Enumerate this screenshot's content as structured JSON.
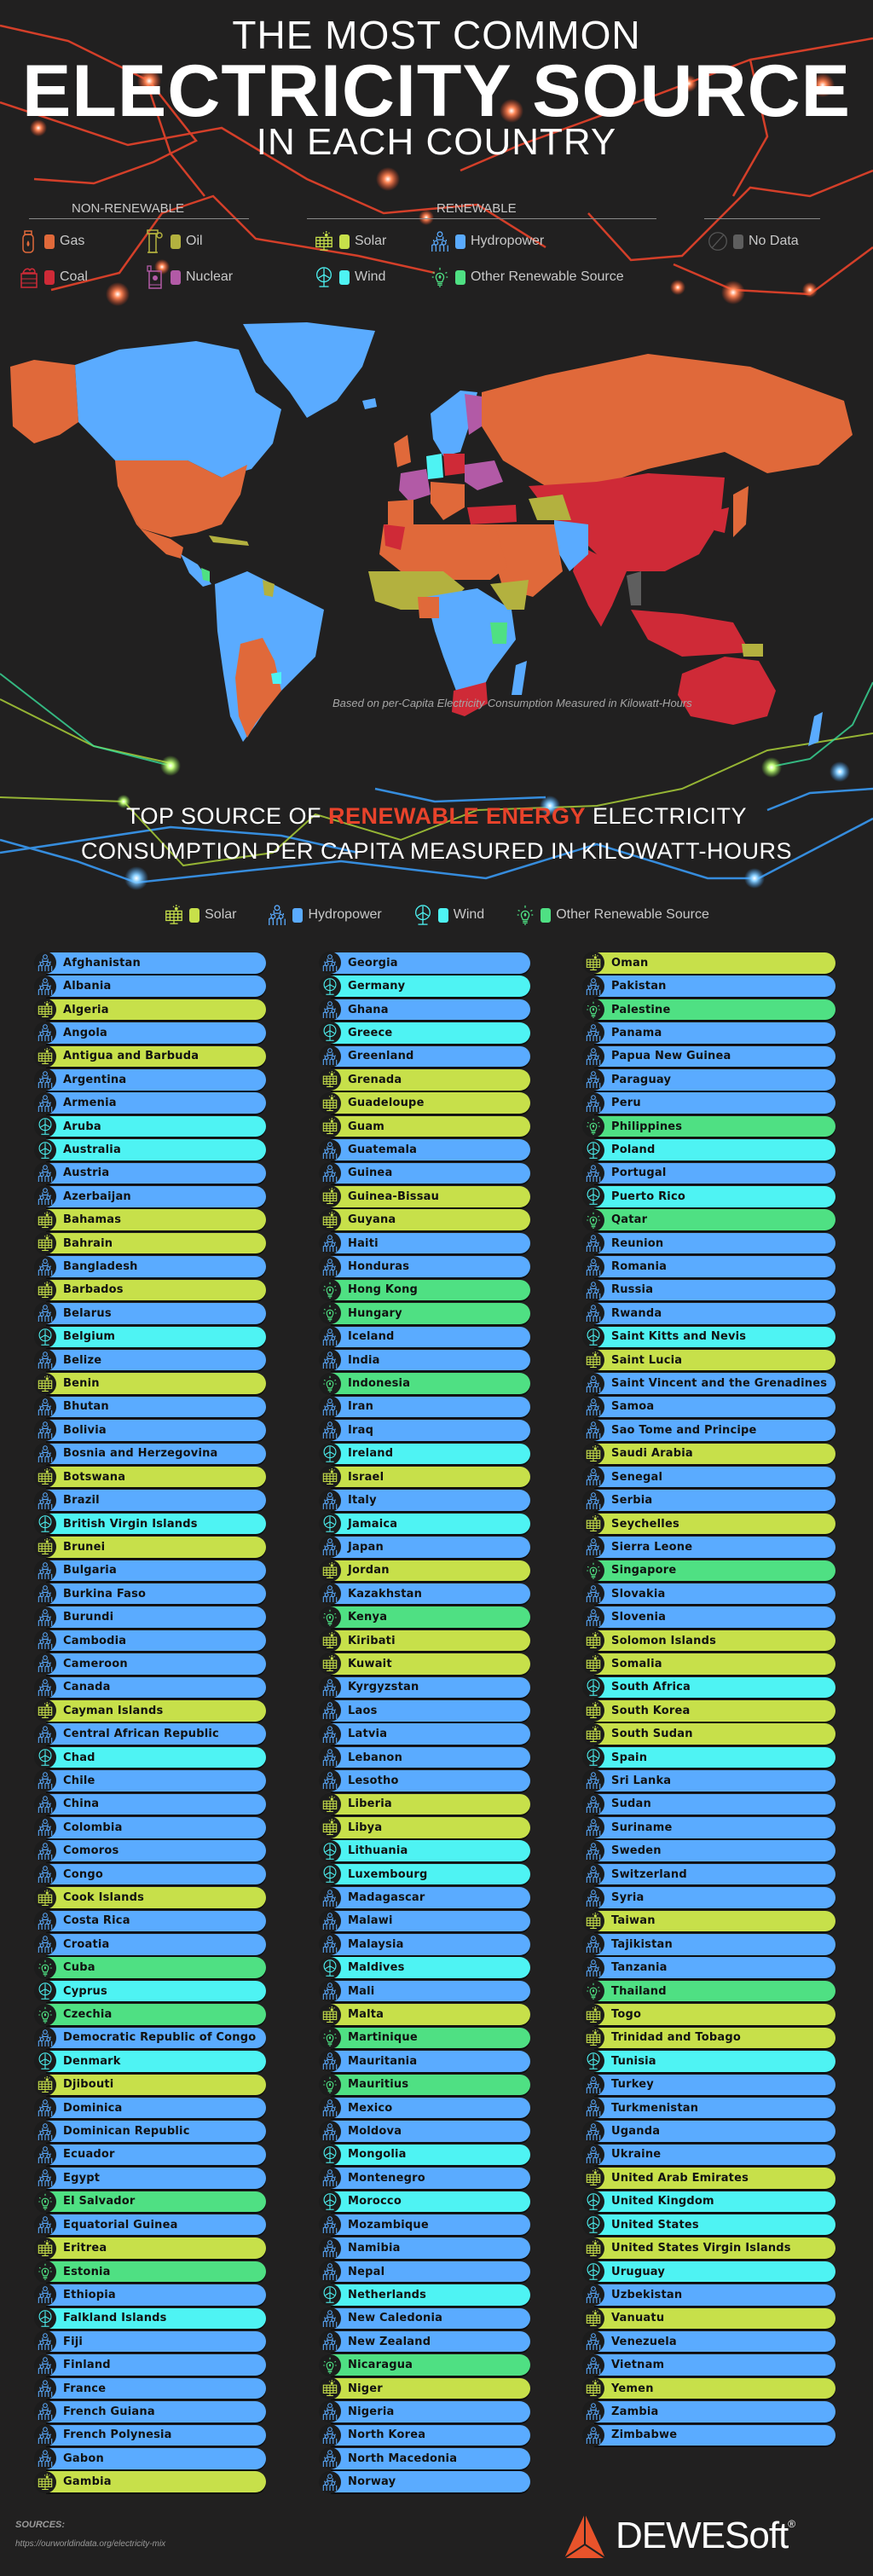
{
  "header": {
    "line1": "THE MOST COMMON",
    "line2": "ELECTRICITY SOURCE",
    "line3": "IN EACH COUNTRY"
  },
  "colors": {
    "gas": "#e0693a",
    "coal": "#cf2a37",
    "oil": "#b3b13f",
    "nuclear": "#b25aa6",
    "solar": "#c7e04a",
    "hydropower": "#5aabff",
    "wind": "#4ef3f3",
    "other": "#4fe083",
    "nodata": "#5e5e5e",
    "accent": "#e8432b",
    "background": "#212020"
  },
  "legend": {
    "non_renewable_title": "NON-RENEWABLE",
    "renewable_title": "RENEWABLE",
    "items": {
      "gas": "Gas",
      "oil": "Oil",
      "coal": "Coal",
      "nuclear": "Nuclear",
      "solar": "Solar",
      "hydropower": "Hydropower",
      "wind": "Wind",
      "other": "Other Renewable Source",
      "nodata": "No Data"
    }
  },
  "map": {
    "note": "Based on per-Capita Electricity Consumption Measured in Kilowatt-Hours"
  },
  "section2": {
    "line1_pre": "TOP SOURCE OF ",
    "line1_accent": "RENEWABLE ENERGY",
    "line1_post": " ELECTRICITY",
    "line2": "CONSUMPTION PER CAPITA MEASURED IN KILOWATT-HOURS",
    "legend": {
      "solar": "Solar",
      "hydropower": "Hydropower",
      "wind": "Wind",
      "other": "Other Renewable Source"
    }
  },
  "countries": {
    "col1": [
      {
        "name": "Afghanistan",
        "source": "hydropower"
      },
      {
        "name": "Albania",
        "source": "hydropower"
      },
      {
        "name": "Algeria",
        "source": "solar"
      },
      {
        "name": "Angola",
        "source": "hydropower"
      },
      {
        "name": "Antigua and Barbuda",
        "source": "solar"
      },
      {
        "name": "Argentina",
        "source": "hydropower"
      },
      {
        "name": "Armenia",
        "source": "hydropower"
      },
      {
        "name": "Aruba",
        "source": "wind"
      },
      {
        "name": "Australia",
        "source": "wind"
      },
      {
        "name": "Austria",
        "source": "hydropower"
      },
      {
        "name": "Azerbaijan",
        "source": "hydropower"
      },
      {
        "name": "Bahamas",
        "source": "solar"
      },
      {
        "name": "Bahrain",
        "source": "solar"
      },
      {
        "name": "Bangladesh",
        "source": "hydropower"
      },
      {
        "name": "Barbados",
        "source": "solar"
      },
      {
        "name": "Belarus",
        "source": "hydropower"
      },
      {
        "name": "Belgium",
        "source": "wind"
      },
      {
        "name": "Belize",
        "source": "hydropower"
      },
      {
        "name": "Benin",
        "source": "solar"
      },
      {
        "name": "Bhutan",
        "source": "hydropower"
      },
      {
        "name": "Bolivia",
        "source": "hydropower"
      },
      {
        "name": "Bosnia and Herzegovina",
        "source": "hydropower"
      },
      {
        "name": "Botswana",
        "source": "solar"
      },
      {
        "name": "Brazil",
        "source": "hydropower"
      },
      {
        "name": "British Virgin Islands",
        "source": "wind"
      },
      {
        "name": "Brunei",
        "source": "solar"
      },
      {
        "name": "Bulgaria",
        "source": "hydropower"
      },
      {
        "name": "Burkina Faso",
        "source": "hydropower"
      },
      {
        "name": "Burundi",
        "source": "hydropower"
      },
      {
        "name": "Cambodia",
        "source": "hydropower"
      },
      {
        "name": "Cameroon",
        "source": "hydropower"
      },
      {
        "name": "Canada",
        "source": "hydropower"
      },
      {
        "name": "Cayman Islands",
        "source": "solar"
      },
      {
        "name": "Central African Republic",
        "source": "hydropower"
      },
      {
        "name": "Chad",
        "source": "wind"
      },
      {
        "name": "Chile",
        "source": "hydropower"
      },
      {
        "name": "China",
        "source": "hydropower"
      },
      {
        "name": "Colombia",
        "source": "hydropower"
      },
      {
        "name": "Comoros",
        "source": "hydropower"
      },
      {
        "name": "Congo",
        "source": "hydropower"
      },
      {
        "name": "Cook Islands",
        "source": "solar"
      },
      {
        "name": "Costa Rica",
        "source": "hydropower"
      },
      {
        "name": "Croatia",
        "source": "hydropower"
      },
      {
        "name": "Cuba",
        "source": "other"
      },
      {
        "name": "Cyprus",
        "source": "wind"
      },
      {
        "name": "Czechia",
        "source": "other"
      },
      {
        "name": "Democratic Republic of Congo",
        "source": "hydropower"
      },
      {
        "name": "Denmark",
        "source": "wind"
      },
      {
        "name": "Djibouti",
        "source": "solar"
      },
      {
        "name": "Dominica",
        "source": "hydropower"
      },
      {
        "name": "Dominican Republic",
        "source": "hydropower"
      },
      {
        "name": "Ecuador",
        "source": "hydropower"
      },
      {
        "name": "Egypt",
        "source": "hydropower"
      },
      {
        "name": "El Salvador",
        "source": "other"
      },
      {
        "name": "Equatorial Guinea",
        "source": "hydropower"
      },
      {
        "name": "Eritrea",
        "source": "solar"
      },
      {
        "name": "Estonia",
        "source": "other"
      },
      {
        "name": "Ethiopia",
        "source": "hydropower"
      },
      {
        "name": "Falkland Islands",
        "source": "wind"
      },
      {
        "name": "Fiji",
        "source": "hydropower"
      },
      {
        "name": "Finland",
        "source": "hydropower"
      },
      {
        "name": "France",
        "source": "hydropower"
      },
      {
        "name": "French Guiana",
        "source": "hydropower"
      },
      {
        "name": "French Polynesia",
        "source": "hydropower"
      },
      {
        "name": "Gabon",
        "source": "hydropower"
      },
      {
        "name": "Gambia",
        "source": "solar"
      }
    ],
    "col2": [
      {
        "name": "Georgia",
        "source": "hydropower"
      },
      {
        "name": "Germany",
        "source": "wind"
      },
      {
        "name": "Ghana",
        "source": "hydropower"
      },
      {
        "name": "Greece",
        "source": "wind"
      },
      {
        "name": "Greenland",
        "source": "hydropower"
      },
      {
        "name": "Grenada",
        "source": "solar"
      },
      {
        "name": "Guadeloupe",
        "source": "solar"
      },
      {
        "name": "Guam",
        "source": "solar"
      },
      {
        "name": "Guatemala",
        "source": "hydropower"
      },
      {
        "name": "Guinea",
        "source": "hydropower"
      },
      {
        "name": "Guinea-Bissau",
        "source": "solar"
      },
      {
        "name": "Guyana",
        "source": "solar"
      },
      {
        "name": "Haiti",
        "source": "hydropower"
      },
      {
        "name": "Honduras",
        "source": "hydropower"
      },
      {
        "name": "Hong Kong",
        "source": "other"
      },
      {
        "name": "Hungary",
        "source": "other"
      },
      {
        "name": "Iceland",
        "source": "hydropower"
      },
      {
        "name": "India",
        "source": "hydropower"
      },
      {
        "name": "Indonesia",
        "source": "other"
      },
      {
        "name": "Iran",
        "source": "hydropower"
      },
      {
        "name": "Iraq",
        "source": "hydropower"
      },
      {
        "name": "Ireland",
        "source": "wind"
      },
      {
        "name": "Israel",
        "source": "solar"
      },
      {
        "name": "Italy",
        "source": "hydropower"
      },
      {
        "name": "Jamaica",
        "source": "wind"
      },
      {
        "name": "Japan",
        "source": "hydropower"
      },
      {
        "name": "Jordan",
        "source": "solar"
      },
      {
        "name": "Kazakhstan",
        "source": "hydropower"
      },
      {
        "name": "Kenya",
        "source": "other"
      },
      {
        "name": "Kiribati",
        "source": "solar"
      },
      {
        "name": "Kuwait",
        "source": "solar"
      },
      {
        "name": "Kyrgyzstan",
        "source": "hydropower"
      },
      {
        "name": "Laos",
        "source": "hydropower"
      },
      {
        "name": "Latvia",
        "source": "hydropower"
      },
      {
        "name": "Lebanon",
        "source": "hydropower"
      },
      {
        "name": "Lesotho",
        "source": "hydropower"
      },
      {
        "name": "Liberia",
        "source": "solar"
      },
      {
        "name": "Libya",
        "source": "solar"
      },
      {
        "name": "Lithuania",
        "source": "wind"
      },
      {
        "name": "Luxembourg",
        "source": "wind"
      },
      {
        "name": "Madagascar",
        "source": "hydropower"
      },
      {
        "name": "Malawi",
        "source": "hydropower"
      },
      {
        "name": "Malaysia",
        "source": "hydropower"
      },
      {
        "name": "Maldives",
        "source": "wind"
      },
      {
        "name": "Mali",
        "source": "hydropower"
      },
      {
        "name": "Malta",
        "source": "solar"
      },
      {
        "name": "Martinique",
        "source": "other"
      },
      {
        "name": "Mauritania",
        "source": "hydropower"
      },
      {
        "name": "Mauritius",
        "source": "other"
      },
      {
        "name": "Mexico",
        "source": "hydropower"
      },
      {
        "name": "Moldova",
        "source": "hydropower"
      },
      {
        "name": "Mongolia",
        "source": "wind"
      },
      {
        "name": "Montenegro",
        "source": "hydropower"
      },
      {
        "name": "Morocco",
        "source": "wind"
      },
      {
        "name": "Mozambique",
        "source": "hydropower"
      },
      {
        "name": "Namibia",
        "source": "hydropower"
      },
      {
        "name": "Nepal",
        "source": "hydropower"
      },
      {
        "name": "Netherlands",
        "source": "wind"
      },
      {
        "name": "New Caledonia",
        "source": "hydropower"
      },
      {
        "name": "New Zealand",
        "source": "hydropower"
      },
      {
        "name": "Nicaragua",
        "source": "other"
      },
      {
        "name": "Niger",
        "source": "solar"
      },
      {
        "name": "Nigeria",
        "source": "hydropower"
      },
      {
        "name": "North Korea",
        "source": "hydropower"
      },
      {
        "name": "North Macedonia",
        "source": "hydropower"
      },
      {
        "name": "Norway",
        "source": "hydropower"
      }
    ],
    "col3": [
      {
        "name": "Oman",
        "source": "solar"
      },
      {
        "name": "Pakistan",
        "source": "hydropower"
      },
      {
        "name": "Palestine",
        "source": "other"
      },
      {
        "name": "Panama",
        "source": "hydropower"
      },
      {
        "name": "Papua New Guinea",
        "source": "hydropower"
      },
      {
        "name": "Paraguay",
        "source": "hydropower"
      },
      {
        "name": "Peru",
        "source": "hydropower"
      },
      {
        "name": "Philippines",
        "source": "other"
      },
      {
        "name": "Poland",
        "source": "wind"
      },
      {
        "name": "Portugal",
        "source": "hydropower"
      },
      {
        "name": "Puerto Rico",
        "source": "wind"
      },
      {
        "name": "Qatar",
        "source": "other"
      },
      {
        "name": "Reunion",
        "source": "hydropower"
      },
      {
        "name": "Romania",
        "source": "hydropower"
      },
      {
        "name": "Russia",
        "source": "hydropower"
      },
      {
        "name": "Rwanda",
        "source": "hydropower"
      },
      {
        "name": "Saint Kitts and Nevis",
        "source": "wind"
      },
      {
        "name": "Saint Lucia",
        "source": "solar"
      },
      {
        "name": "Saint Vincent and the Grenadines",
        "source": "hydropower"
      },
      {
        "name": "Samoa",
        "source": "hydropower"
      },
      {
        "name": "Sao Tome and Principe",
        "source": "hydropower"
      },
      {
        "name": "Saudi Arabia",
        "source": "solar"
      },
      {
        "name": "Senegal",
        "source": "hydropower"
      },
      {
        "name": "Serbia",
        "source": "hydropower"
      },
      {
        "name": "Seychelles",
        "source": "solar"
      },
      {
        "name": "Sierra Leone",
        "source": "hydropower"
      },
      {
        "name": "Singapore",
        "source": "other"
      },
      {
        "name": "Slovakia",
        "source": "hydropower"
      },
      {
        "name": "Slovenia",
        "source": "hydropower"
      },
      {
        "name": "Solomon Islands",
        "source": "solar"
      },
      {
        "name": "Somalia",
        "source": "solar"
      },
      {
        "name": "South Africa",
        "source": "wind"
      },
      {
        "name": "South Korea",
        "source": "solar"
      },
      {
        "name": "South Sudan",
        "source": "solar"
      },
      {
        "name": "Spain",
        "source": "wind"
      },
      {
        "name": "Sri Lanka",
        "source": "hydropower"
      },
      {
        "name": "Sudan",
        "source": "hydropower"
      },
      {
        "name": "Suriname",
        "source": "hydropower"
      },
      {
        "name": "Sweden",
        "source": "hydropower"
      },
      {
        "name": "Switzerland",
        "source": "hydropower"
      },
      {
        "name": "Syria",
        "source": "hydropower"
      },
      {
        "name": "Taiwan",
        "source": "solar"
      },
      {
        "name": "Tajikistan",
        "source": "hydropower"
      },
      {
        "name": "Tanzania",
        "source": "hydropower"
      },
      {
        "name": "Thailand",
        "source": "other"
      },
      {
        "name": "Togo",
        "source": "solar"
      },
      {
        "name": "Trinidad and Tobago",
        "source": "solar"
      },
      {
        "name": "Tunisia",
        "source": "wind"
      },
      {
        "name": "Turkey",
        "source": "hydropower"
      },
      {
        "name": "Turkmenistan",
        "source": "hydropower"
      },
      {
        "name": "Uganda",
        "source": "hydropower"
      },
      {
        "name": "Ukraine",
        "source": "hydropower"
      },
      {
        "name": "United Arab Emirates",
        "source": "solar"
      },
      {
        "name": "United Kingdom",
        "source": "wind"
      },
      {
        "name": "United States",
        "source": "wind"
      },
      {
        "name": "United States Virgin Islands",
        "source": "solar"
      },
      {
        "name": "Uruguay",
        "source": "wind"
      },
      {
        "name": "Uzbekistan",
        "source": "hydropower"
      },
      {
        "name": "Vanuatu",
        "source": "solar"
      },
      {
        "name": "Venezuela",
        "source": "hydropower"
      },
      {
        "name": "Vietnam",
        "source": "hydropower"
      },
      {
        "name": "Yemen",
        "source": "solar"
      },
      {
        "name": "Zambia",
        "source": "hydropower"
      },
      {
        "name": "Zimbabwe",
        "source": "hydropower"
      }
    ]
  },
  "icons": {
    "gas": "gas-cylinder-icon",
    "oil": "oil-barrel-icon",
    "coal": "coal-cart-icon",
    "nuclear": "nuclear-plant-icon",
    "solar": "solar-panel-icon",
    "hydropower": "hydropower-dam-icon",
    "wind": "wind-turbine-icon",
    "other": "lightbulb-icon",
    "nodata": "no-data-icon"
  },
  "footer": {
    "sources_label": "SOURCES:",
    "sources_url": "https://ourworldindata.org/electricity-mix",
    "brand": "DEWESoft",
    "brand_mark": "®"
  }
}
